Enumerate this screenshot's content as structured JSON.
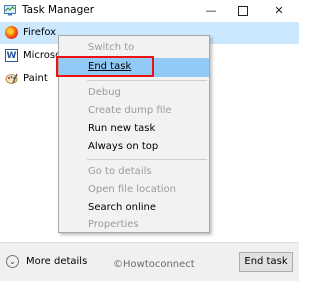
{
  "window": {
    "title": "Task Manager",
    "controls": {
      "minimize": "—",
      "close": "✕"
    }
  },
  "processes": [
    {
      "name": "Firefox",
      "icon": "firefox-icon",
      "selected": true
    },
    {
      "name": "Microso",
      "icon": "word-icon",
      "icon_text": "W"
    },
    {
      "name": "Paint",
      "icon": "paint-icon"
    }
  ],
  "context_menu": {
    "items": [
      {
        "label": "Switch to",
        "enabled": false
      },
      {
        "label": "End task",
        "enabled": true,
        "highlighted": true
      },
      {
        "label": "Debug",
        "enabled": false
      },
      {
        "label": "Create dump file",
        "enabled": false
      },
      {
        "label": "Run new task",
        "enabled": true
      },
      {
        "label": "Always on top",
        "enabled": true
      },
      {
        "label": "Go to details",
        "enabled": false
      },
      {
        "label": "Open file location",
        "enabled": false
      },
      {
        "label": "Search online",
        "enabled": true
      },
      {
        "label": "Properties",
        "enabled": false
      }
    ]
  },
  "footer": {
    "more_details": "More details",
    "end_task_button": "End task",
    "watermark": "©Howtoconnect"
  },
  "colors": {
    "selection": "#cce8ff",
    "menu_highlight": "#91c9f7",
    "annotation_box": "#ee1111"
  }
}
